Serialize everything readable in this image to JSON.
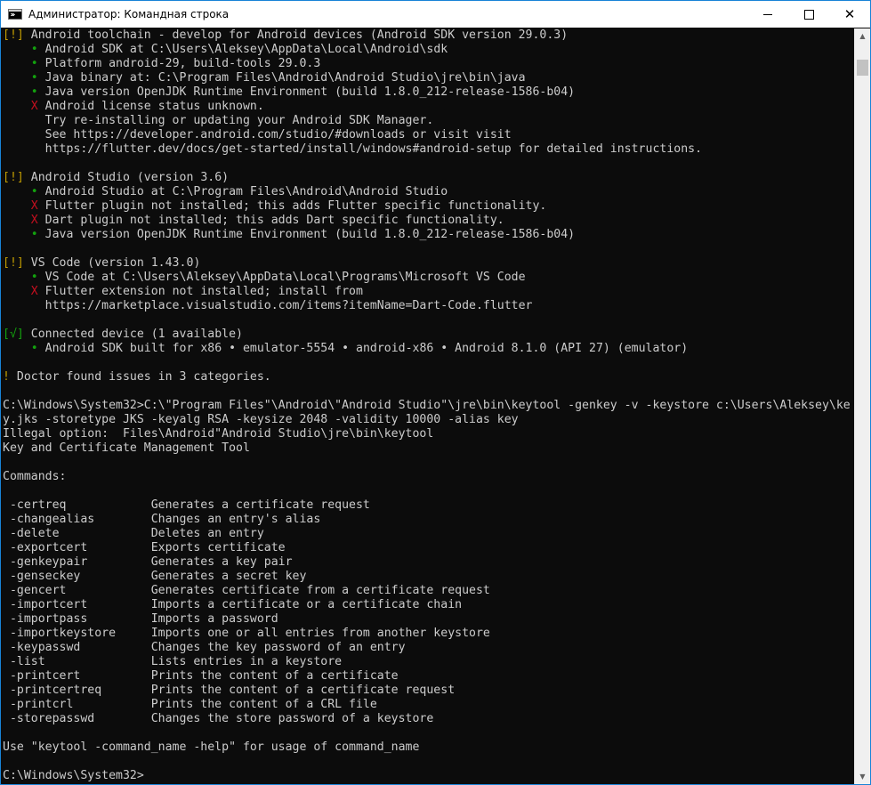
{
  "window": {
    "title": "Администратор: Командная строка",
    "minimize_glyph": "",
    "maximize_glyph": "",
    "close_glyph": "✕"
  },
  "scrollbar": {
    "up_arrow": "▲",
    "down_arrow": "▼"
  },
  "colors": {
    "console_bg": "#0c0c0c",
    "console_text": "#cccccc",
    "warning_yellow": "#c19c00",
    "ok_green": "#13a10e",
    "error_red": "#c50f1f",
    "titlebar_bg": "#ffffff"
  },
  "console": {
    "lines": [
      {
        "segments": [
          {
            "text": "[!]",
            "color": "yellow"
          },
          {
            "text": " Android toolchain - develop for Android devices (Android SDK version 29.0.3)",
            "color": "default"
          }
        ]
      },
      {
        "segments": [
          {
            "text": "    ",
            "color": "default"
          },
          {
            "text": "•",
            "color": "green"
          },
          {
            "text": " Android SDK at C:\\Users\\Aleksey\\AppData\\Local\\Android\\sdk",
            "color": "default"
          }
        ]
      },
      {
        "segments": [
          {
            "text": "    ",
            "color": "default"
          },
          {
            "text": "•",
            "color": "green"
          },
          {
            "text": " Platform android-29, build-tools 29.0.3",
            "color": "default"
          }
        ]
      },
      {
        "segments": [
          {
            "text": "    ",
            "color": "default"
          },
          {
            "text": "•",
            "color": "green"
          },
          {
            "text": " Java binary at: C:\\Program Files\\Android\\Android Studio\\jre\\bin\\java",
            "color": "default"
          }
        ]
      },
      {
        "segments": [
          {
            "text": "    ",
            "color": "default"
          },
          {
            "text": "•",
            "color": "green"
          },
          {
            "text": " Java version OpenJDK Runtime Environment (build 1.8.0_212-release-1586-b04)",
            "color": "default"
          }
        ]
      },
      {
        "segments": [
          {
            "text": "    ",
            "color": "default"
          },
          {
            "text": "X",
            "color": "red"
          },
          {
            "text": " Android license status unknown.",
            "color": "default"
          }
        ]
      },
      {
        "segments": [
          {
            "text": "      Try re-installing or updating your Android SDK Manager.",
            "color": "default"
          }
        ]
      },
      {
        "segments": [
          {
            "text": "      See https://developer.android.com/studio/#downloads or visit visit",
            "color": "default"
          }
        ]
      },
      {
        "segments": [
          {
            "text": "      https://flutter.dev/docs/get-started/install/windows#android-setup for detailed instructions.",
            "color": "default"
          }
        ]
      },
      {
        "segments": [
          {
            "text": "",
            "color": "default"
          }
        ]
      },
      {
        "segments": [
          {
            "text": "[!]",
            "color": "yellow"
          },
          {
            "text": " Android Studio (version 3.6)",
            "color": "default"
          }
        ]
      },
      {
        "segments": [
          {
            "text": "    ",
            "color": "default"
          },
          {
            "text": "•",
            "color": "green"
          },
          {
            "text": " Android Studio at C:\\Program Files\\Android\\Android Studio",
            "color": "default"
          }
        ]
      },
      {
        "segments": [
          {
            "text": "    ",
            "color": "default"
          },
          {
            "text": "X",
            "color": "red"
          },
          {
            "text": " Flutter plugin not installed; this adds Flutter specific functionality.",
            "color": "default"
          }
        ]
      },
      {
        "segments": [
          {
            "text": "    ",
            "color": "default"
          },
          {
            "text": "X",
            "color": "red"
          },
          {
            "text": " Dart plugin not installed; this adds Dart specific functionality.",
            "color": "default"
          }
        ]
      },
      {
        "segments": [
          {
            "text": "    ",
            "color": "default"
          },
          {
            "text": "•",
            "color": "green"
          },
          {
            "text": " Java version OpenJDK Runtime Environment (build 1.8.0_212-release-1586-b04)",
            "color": "default"
          }
        ]
      },
      {
        "segments": [
          {
            "text": "",
            "color": "default"
          }
        ]
      },
      {
        "segments": [
          {
            "text": "[!]",
            "color": "yellow"
          },
          {
            "text": " VS Code (version 1.43.0)",
            "color": "default"
          }
        ]
      },
      {
        "segments": [
          {
            "text": "    ",
            "color": "default"
          },
          {
            "text": "•",
            "color": "green"
          },
          {
            "text": " VS Code at C:\\Users\\Aleksey\\AppData\\Local\\Programs\\Microsoft VS Code",
            "color": "default"
          }
        ]
      },
      {
        "segments": [
          {
            "text": "    ",
            "color": "default"
          },
          {
            "text": "X",
            "color": "red"
          },
          {
            "text": " Flutter extension not installed; install from",
            "color": "default"
          }
        ]
      },
      {
        "segments": [
          {
            "text": "      https://marketplace.visualstudio.com/items?itemName=Dart-Code.flutter",
            "color": "default"
          }
        ]
      },
      {
        "segments": [
          {
            "text": "",
            "color": "default"
          }
        ]
      },
      {
        "segments": [
          {
            "text": "[√]",
            "color": "green"
          },
          {
            "text": " Connected device (1 available)",
            "color": "default"
          }
        ]
      },
      {
        "segments": [
          {
            "text": "    ",
            "color": "default"
          },
          {
            "text": "•",
            "color": "green"
          },
          {
            "text": " Android SDK built for x86 • emulator-5554 • android-x86 • Android 8.1.0 (API 27) (emulator)",
            "color": "default"
          }
        ]
      },
      {
        "segments": [
          {
            "text": "",
            "color": "default"
          }
        ]
      },
      {
        "segments": [
          {
            "text": "!",
            "color": "yellow"
          },
          {
            "text": " Doctor found issues in 3 categories.",
            "color": "default"
          }
        ]
      },
      {
        "segments": [
          {
            "text": "",
            "color": "default"
          }
        ]
      },
      {
        "segments": [
          {
            "text": "C:\\Windows\\System32>C:\\\"Program Files\"\\Android\\\"Android Studio\"\\jre\\bin\\keytool -genkey -v -keystore c:\\Users\\Aleksey\\ke",
            "color": "default"
          }
        ]
      },
      {
        "segments": [
          {
            "text": "y.jks -storetype JKS -keyalg RSA -keysize 2048 -validity 10000 -alias key",
            "color": "default"
          }
        ]
      },
      {
        "segments": [
          {
            "text": "Illegal option:  Files\\Android\"Android Studio\\jre\\bin\\keytool",
            "color": "default"
          }
        ]
      },
      {
        "segments": [
          {
            "text": "Key and Certificate Management Tool",
            "color": "default"
          }
        ]
      },
      {
        "segments": [
          {
            "text": "",
            "color": "default"
          }
        ]
      },
      {
        "segments": [
          {
            "text": "Commands:",
            "color": "default"
          }
        ]
      },
      {
        "segments": [
          {
            "text": "",
            "color": "default"
          }
        ]
      },
      {
        "segments": [
          {
            "text": " -certreq            Generates a certificate request",
            "color": "default"
          }
        ]
      },
      {
        "segments": [
          {
            "text": " -changealias        Changes an entry's alias",
            "color": "default"
          }
        ]
      },
      {
        "segments": [
          {
            "text": " -delete             Deletes an entry",
            "color": "default"
          }
        ]
      },
      {
        "segments": [
          {
            "text": " -exportcert         Exports certificate",
            "color": "default"
          }
        ]
      },
      {
        "segments": [
          {
            "text": " -genkeypair         Generates a key pair",
            "color": "default"
          }
        ]
      },
      {
        "segments": [
          {
            "text": " -genseckey          Generates a secret key",
            "color": "default"
          }
        ]
      },
      {
        "segments": [
          {
            "text": " -gencert            Generates certificate from a certificate request",
            "color": "default"
          }
        ]
      },
      {
        "segments": [
          {
            "text": " -importcert         Imports a certificate or a certificate chain",
            "color": "default"
          }
        ]
      },
      {
        "segments": [
          {
            "text": " -importpass         Imports a password",
            "color": "default"
          }
        ]
      },
      {
        "segments": [
          {
            "text": " -importkeystore     Imports one or all entries from another keystore",
            "color": "default"
          }
        ]
      },
      {
        "segments": [
          {
            "text": " -keypasswd          Changes the key password of an entry",
            "color": "default"
          }
        ]
      },
      {
        "segments": [
          {
            "text": " -list               Lists entries in a keystore",
            "color": "default"
          }
        ]
      },
      {
        "segments": [
          {
            "text": " -printcert          Prints the content of a certificate",
            "color": "default"
          }
        ]
      },
      {
        "segments": [
          {
            "text": " -printcertreq       Prints the content of a certificate request",
            "color": "default"
          }
        ]
      },
      {
        "segments": [
          {
            "text": " -printcrl           Prints the content of a CRL file",
            "color": "default"
          }
        ]
      },
      {
        "segments": [
          {
            "text": " -storepasswd        Changes the store password of a keystore",
            "color": "default"
          }
        ]
      },
      {
        "segments": [
          {
            "text": "",
            "color": "default"
          }
        ]
      },
      {
        "segments": [
          {
            "text": "Use \"keytool -command_name -help\" for usage of command_name",
            "color": "default"
          }
        ]
      },
      {
        "segments": [
          {
            "text": "",
            "color": "default"
          }
        ]
      },
      {
        "segments": [
          {
            "text": "C:\\Windows\\System32>",
            "color": "default"
          }
        ]
      }
    ]
  }
}
